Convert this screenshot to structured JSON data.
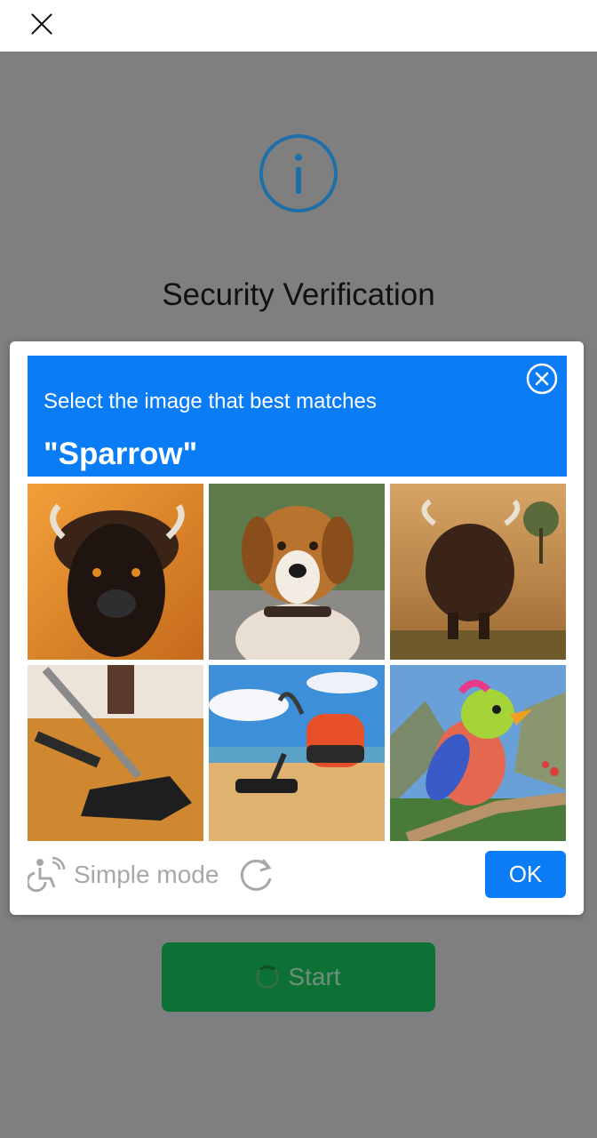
{
  "header": {
    "close_icon": "close-icon"
  },
  "page": {
    "title": "Security Verification",
    "info_icon": "info-icon"
  },
  "start": {
    "label": "Start"
  },
  "captcha": {
    "instruction": "Select the image that best matches",
    "target": "\"Sparrow\"",
    "tiles": [
      {
        "subject": "bison"
      },
      {
        "subject": "dog"
      },
      {
        "subject": "bison"
      },
      {
        "subject": "vacuum cleaner"
      },
      {
        "subject": "vacuum cleaner"
      },
      {
        "subject": "bird"
      }
    ],
    "simple_mode_label": "Simple mode",
    "ok_label": "OK"
  },
  "colors": {
    "accent": "#0a7cf5",
    "start_button": "#0d7034",
    "overlay": "#7f7f7f"
  }
}
